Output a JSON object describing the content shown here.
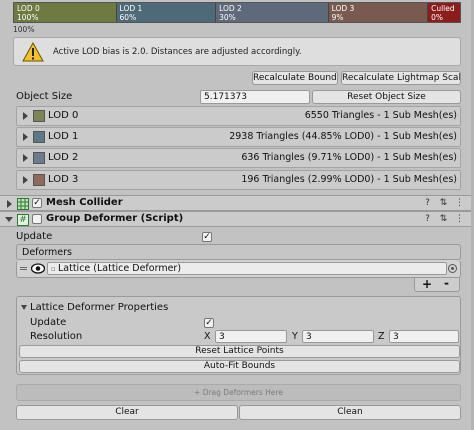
{
  "lod_group": {
    "segments": [
      {
        "name": "LOD 0",
        "percent": "100%",
        "color": "#6f7a42",
        "width": 103
      },
      {
        "name": "LOD 1",
        "percent": "60%",
        "color": "#4e6a78",
        "width": 100
      },
      {
        "name": "LOD 2",
        "percent": "30%",
        "color": "#5e6a7a",
        "width": 113
      },
      {
        "name": "LOD 3",
        "percent": "9%",
        "color": "#7a5a4e",
        "width": 100
      },
      {
        "name": "Culled",
        "percent": "0%",
        "color": "#8c1d1d",
        "width": 32
      }
    ],
    "below_percent": "100%",
    "help_text": "Active LOD bias is 2.0. Distances are adjusted accordingly.",
    "recalculate_bounds_label": "Recalculate Bounds",
    "recalculate_lightmap_label": "Recalculate Lightmap Scale",
    "object_size_label": "Object Size",
    "object_size_value": "5.171373",
    "reset_object_size_label": "Reset Object Size",
    "lods": [
      {
        "name": "LOD 0",
        "color": "#7e8555",
        "desc": "6550 Triangles - 1 Sub Mesh(es)"
      },
      {
        "name": "LOD 1",
        "color": "#5b7a88",
        "desc": "2938 Triangles (44.85% LOD0) - 1 Sub Mesh(es)"
      },
      {
        "name": "LOD 2",
        "color": "#6d7b8d",
        "desc": "636 Triangles (9.71% LOD0) - 1 Sub Mesh(es)"
      },
      {
        "name": "LOD 3",
        "color": "#8f6a5c",
        "desc": "196 Triangles (2.99% LOD0) - 1 Sub Mesh(es)"
      }
    ]
  },
  "mesh_collider": {
    "title": "Mesh Collider",
    "enabled_mark": "✓"
  },
  "group_deformer": {
    "title": "Group Deformer (Script)",
    "hash_icon_text": "#",
    "update_label": "Update",
    "update_mark": "✓",
    "deformers_header": "Deformers",
    "deformer_item": "Lattice (Lattice Deformer)",
    "add_label": "+",
    "remove_label": "-",
    "props_title": "Lattice Deformer Properties",
    "props_update_label": "Update",
    "props_update_mark": "✓",
    "resolution_label": "Resolution",
    "x_label": "X",
    "x_value": "3",
    "y_label": "Y",
    "y_value": "3",
    "z_label": "Z",
    "z_value": "3",
    "reset_lattice_label": "Reset Lattice Points",
    "autofit_label": "Auto-Fit Bounds",
    "drag_hint": "+ Drag Deformers Here",
    "clear_label": "Clear",
    "clean_label": "Clean"
  },
  "header_icons": {
    "help": "?",
    "settings": "⇅",
    "menu": "⋮"
  }
}
